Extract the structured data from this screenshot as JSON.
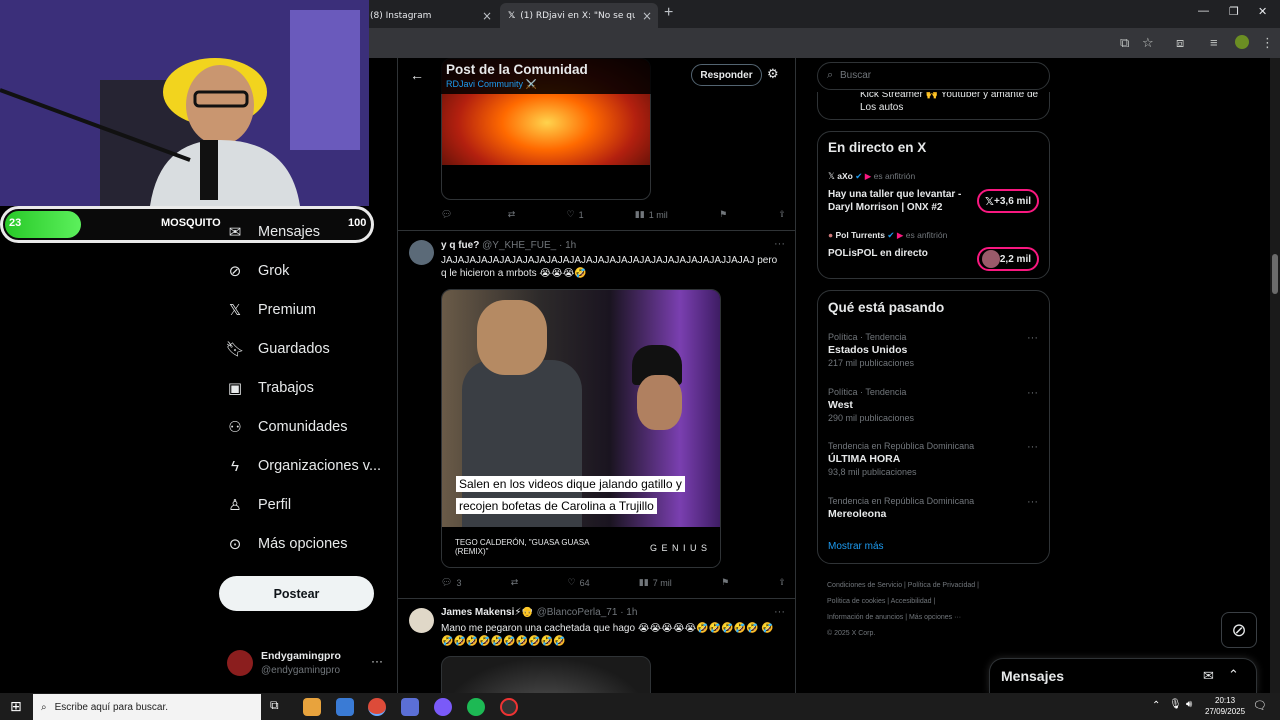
{
  "browser": {
    "tabs": [
      {
        "label": "(8) Instagram"
      },
      {
        "label": "(1) RDjavi en X: \"No se quien e..."
      }
    ],
    "new_tab": "+"
  },
  "nav": {
    "items": [
      {
        "label": "Mensajes",
        "icon": "envelope-icon"
      },
      {
        "label": "Grok",
        "icon": "grok-icon"
      },
      {
        "label": "Premium",
        "icon": "x-logo-icon"
      },
      {
        "label": "Guardados",
        "icon": "bookmark-icon"
      },
      {
        "label": "Trabajos",
        "icon": "briefcase-icon"
      },
      {
        "label": "Comunidades",
        "icon": "people-icon"
      },
      {
        "label": "Organizaciones v...",
        "icon": "lightning-icon"
      },
      {
        "label": "Perfil",
        "icon": "person-icon"
      },
      {
        "label": "Más opciones",
        "icon": "more-circle-icon"
      }
    ],
    "post_button": "Postear",
    "profile": {
      "name": "Endygamingpro",
      "handle": "@endygamingpro"
    }
  },
  "hud": {
    "left_value": "23",
    "name": "MOSQUITO",
    "right_value": "100"
  },
  "header": {
    "title": "Post de la Comunidad",
    "subtitle": "RDJavi Community ⚔️",
    "reply_button": "Responder"
  },
  "posts": [
    {
      "actions": {
        "replies": "",
        "reposts": "",
        "likes": "1",
        "views": "1 mil"
      }
    },
    {
      "name": "y q fue?",
      "handle": "@Y_KHE_FUE_",
      "time": "· 1h",
      "text": "JAJAJAJAJAJAJAJAJAJAJAJAJAJAJAJAJAJAJAJAJAJAJAJAJJAJAJ pero q le hicieron a mrbots 😭😭😭🤣",
      "caption_line1": "Salen en los videos dique jalando gatillo y",
      "caption_line2": "recojen bofetas de Carolina a Trujillo",
      "song": "TEGO CALDERÓN, \"GUASA GUASA (REMIX)\"",
      "brand": "G E N I U S",
      "actions": {
        "replies": "3",
        "reposts": "",
        "likes": "64",
        "views": "7 mil"
      }
    },
    {
      "name": "James Makensi⚡👴",
      "handle": "@BlancoPerla_71",
      "time": "· 1h",
      "text": "Mano me pegaron una cachetada que hago 😭😭😭😭😭🤣🤣🤣🤣🤣 🤣🤣🤣🤣🤣🤣🤣🤣🤣🤣🤣"
    }
  ],
  "search": {
    "placeholder": "Buscar"
  },
  "top_snippet": "Kick Streamer 🙌 Youtuber y amante de Los autos",
  "live": {
    "title": "En directo en X",
    "items": [
      {
        "host": "aXo",
        "role": "es anfitrión",
        "title": "Hay una taller que levantar - Daryl Morrison | ONX #2",
        "count": "+3,6 mil"
      },
      {
        "host": "Pol Turrents",
        "role": "es anfitrión",
        "title": "POLisPOL en directo",
        "count": "+2,2 mil"
      }
    ]
  },
  "trends": {
    "title": "Qué está pasando",
    "items": [
      {
        "meta": "Política · Tendencia",
        "title": "Estados Unidos",
        "count": "217 mil publicaciones"
      },
      {
        "meta": "Política · Tendencia",
        "title": "West",
        "count": "290 mil publicaciones"
      },
      {
        "meta": "Tendencia en República Dominicana",
        "title": "ÚLTIMA HORA",
        "count": "93,8 mil publicaciones"
      },
      {
        "meta": "Tendencia en República Dominicana",
        "title": "Mereoleona",
        "count": ""
      }
    ],
    "show_more": "Mostrar más"
  },
  "footer": {
    "line1": "Condiciones de Servicio  |  Política de Privacidad  |",
    "line2": "Política de cookies  |  Accesibilidad  |",
    "line3": "Información de anuncios  |  Más opciones ···",
    "line4": "© 2025 X Corp."
  },
  "messages_drawer": {
    "label": "Mensajes"
  },
  "taskbar": {
    "search": "Escribe aquí para buscar.",
    "time": "20:13",
    "date": "27/09/2025"
  },
  "colors": {
    "accent": "#1d9bf0",
    "pink": "#f91880",
    "hud_green": "#3fe03f"
  }
}
